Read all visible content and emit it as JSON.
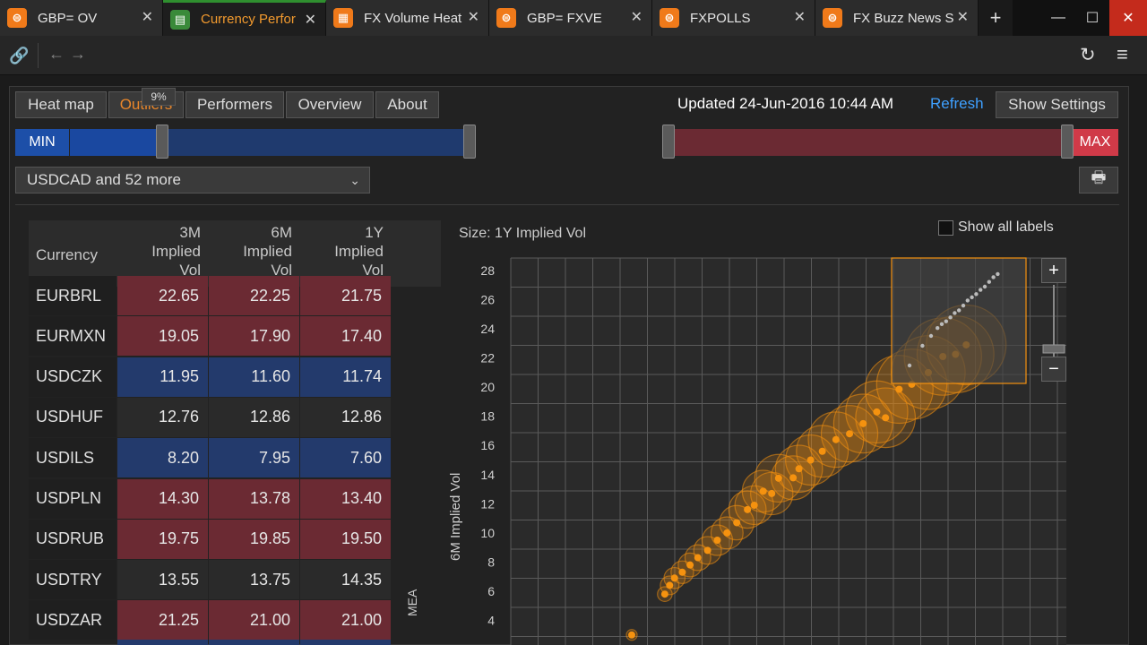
{
  "tabs": [
    {
      "title": "GBP= OV",
      "icon": "refinitiv-logo-icon",
      "active": false
    },
    {
      "title": "Currency Perfor",
      "icon": "app-chart-icon",
      "active": true
    },
    {
      "title": "FX Volume Heat",
      "icon": "heatmap-icon",
      "active": false
    },
    {
      "title": "GBP= FXVE",
      "icon": "refinitiv-logo-icon",
      "active": false
    },
    {
      "title": "FXPOLLS",
      "icon": "refinitiv-logo-icon",
      "active": false
    },
    {
      "title": "FX Buzz News S",
      "icon": "refinitiv-logo-icon",
      "active": false
    }
  ],
  "tab_close_glyph": "✕",
  "tab_add_glyph": "+",
  "window": {
    "minimize": "—",
    "maximize": "☐",
    "close": "✕"
  },
  "toolbar": {
    "link": "🔗",
    "back": "←",
    "forward": "→",
    "refresh": "↻",
    "menu": "≡"
  },
  "view_buttons": [
    "Heat map",
    "Outliers",
    "Performers",
    "Overview",
    "About"
  ],
  "active_view": "Outliers",
  "tooltip_text": "9%",
  "updated_text": "Updated 24-Jun-2016 10:44 AM",
  "refresh_link": "Refresh",
  "show_settings": "Show Settings",
  "range": {
    "min_label": "MIN",
    "max_label": "MAX",
    "colors": {
      "low": "#1d4fa8",
      "mid_low": "#1f3a6e",
      "neutral": "#222222",
      "high": "#6b2a33",
      "max": "#d03a48"
    }
  },
  "currency_select": {
    "value": "USDCAD and 52 more",
    "chevron": "⌄"
  },
  "print_icon": "🖶",
  "table": {
    "headers": [
      "Currency",
      "3M Implied Vol",
      "6M Implied Vol",
      "1Y Implied Vol"
    ],
    "header_lines": [
      [
        "Currency"
      ],
      [
        "3M",
        "Implied",
        "Vol"
      ],
      [
        "6M",
        "Implied",
        "Vol"
      ],
      [
        "1Y",
        "Implied",
        "Vol"
      ]
    ],
    "rows": [
      {
        "ccy": "EURBRL",
        "v3m": "22.65",
        "v6m": "22.25",
        "v1y": "21.75",
        "tone": "red"
      },
      {
        "ccy": "EURMXN",
        "v3m": "19.05",
        "v6m": "17.90",
        "v1y": "17.40",
        "tone": "red"
      },
      {
        "ccy": "USDCZK",
        "v3m": "11.95",
        "v6m": "11.60",
        "v1y": "11.74",
        "tone": "blue"
      },
      {
        "ccy": "USDHUF",
        "v3m": "12.76",
        "v6m": "12.86",
        "v1y": "12.86",
        "tone": "gray"
      },
      {
        "ccy": "USDILS",
        "v3m": "8.20",
        "v6m": "7.95",
        "v1y": "7.60",
        "tone": "blue"
      },
      {
        "ccy": "USDPLN",
        "v3m": "14.30",
        "v6m": "13.78",
        "v1y": "13.40",
        "tone": "red"
      },
      {
        "ccy": "USDRUB",
        "v3m": "19.75",
        "v6m": "19.85",
        "v1y": "19.50",
        "tone": "red"
      },
      {
        "ccy": "USDTRY",
        "v3m": "13.55",
        "v6m": "13.75",
        "v1y": "14.35",
        "tone": "gray"
      },
      {
        "ccy": "USDZAR",
        "v3m": "21.25",
        "v6m": "21.00",
        "v1y": "21.00",
        "tone": "red"
      }
    ],
    "group_label": "MEA"
  },
  "chart": {
    "size_label": "Size: 1Y Implied Vol",
    "show_all_labels": "Show all labels",
    "y_label": "6M Implied Vol",
    "zoom_in": "+",
    "zoom_out": "−"
  },
  "chart_data": {
    "type": "scatter",
    "title": "",
    "xlabel": "",
    "ylabel": "6M Implied Vol",
    "y_ticks": [
      4,
      6,
      8,
      10,
      12,
      14,
      16,
      18,
      20,
      22,
      24,
      26,
      28
    ],
    "ylim": [
      2.5,
      28.5
    ],
    "xlim": [
      2.5,
      28.5
    ],
    "grid": true,
    "marker_color": "#f5920f",
    "points": [
      {
        "x": 6.0,
        "y": 3.0,
        "size": 5
      },
      {
        "x": 7.7,
        "y": 5.8,
        "size": 6
      },
      {
        "x": 7.95,
        "y": 6.4,
        "size": 7
      },
      {
        "x": 8.2,
        "y": 6.9,
        "size": 7.6
      },
      {
        "x": 8.6,
        "y": 7.3,
        "size": 8
      },
      {
        "x": 9.0,
        "y": 7.8,
        "size": 8.3
      },
      {
        "x": 9.4,
        "y": 8.3,
        "size": 8.8
      },
      {
        "x": 9.9,
        "y": 8.8,
        "size": 9.3
      },
      {
        "x": 10.4,
        "y": 9.5,
        "size": 10
      },
      {
        "x": 10.9,
        "y": 10.0,
        "size": 10.4
      },
      {
        "x": 11.4,
        "y": 10.7,
        "size": 11
      },
      {
        "x": 11.95,
        "y": 11.6,
        "size": 11.74
      },
      {
        "x": 12.3,
        "y": 11.9,
        "size": 12.1
      },
      {
        "x": 12.76,
        "y": 12.86,
        "size": 12.86
      },
      {
        "x": 13.2,
        "y": 12.7,
        "size": 13.0
      },
      {
        "x": 13.55,
        "y": 13.75,
        "size": 14.35
      },
      {
        "x": 14.3,
        "y": 13.78,
        "size": 13.4
      },
      {
        "x": 14.6,
        "y": 14.4,
        "size": 14.2
      },
      {
        "x": 15.2,
        "y": 15.0,
        "size": 15.0
      },
      {
        "x": 15.8,
        "y": 15.6,
        "size": 15.4
      },
      {
        "x": 16.5,
        "y": 16.4,
        "size": 16.3
      },
      {
        "x": 17.2,
        "y": 16.8,
        "size": 16.6
      },
      {
        "x": 17.9,
        "y": 17.5,
        "size": 17.2
      },
      {
        "x": 18.6,
        "y": 18.3,
        "size": 18.0
      },
      {
        "x": 19.05,
        "y": 17.9,
        "size": 17.4
      },
      {
        "x": 19.75,
        "y": 19.85,
        "size": 19.5
      },
      {
        "x": 20.4,
        "y": 20.2,
        "size": 20.1
      },
      {
        "x": 21.25,
        "y": 21.0,
        "size": 21.0
      },
      {
        "x": 22.0,
        "y": 22.1,
        "size": 21.9
      },
      {
        "x": 22.65,
        "y": 22.25,
        "size": 21.75
      },
      {
        "x": 23.2,
        "y": 22.9,
        "size": 22.5
      }
    ],
    "navigator": {
      "points": [
        {
          "x": 6.0,
          "y": 3.0
        },
        {
          "x": 9.0,
          "y": 8.0
        },
        {
          "x": 11.0,
          "y": 10.5
        },
        {
          "x": 12.5,
          "y": 12.5
        },
        {
          "x": 13.5,
          "y": 13.5
        },
        {
          "x": 14.5,
          "y": 14.2
        },
        {
          "x": 15.5,
          "y": 15.2
        },
        {
          "x": 16.5,
          "y": 16.3
        },
        {
          "x": 17.5,
          "y": 17.0
        },
        {
          "x": 18.5,
          "y": 18.2
        },
        {
          "x": 19.5,
          "y": 19.5
        },
        {
          "x": 20.5,
          "y": 20.3
        },
        {
          "x": 21.5,
          "y": 21.1
        },
        {
          "x": 22.5,
          "y": 22.2
        },
        {
          "x": 23.5,
          "y": 23.0
        },
        {
          "x": 24.5,
          "y": 24.2
        },
        {
          "x": 25.5,
          "y": 25.4
        },
        {
          "x": 26.5,
          "y": 26.2
        }
      ]
    }
  }
}
